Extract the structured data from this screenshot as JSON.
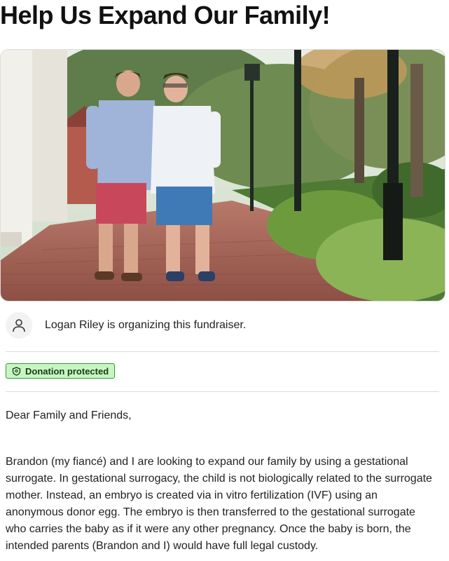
{
  "page": {
    "title": "Help Us Expand Our Family!"
  },
  "hero": {
    "image_icon": "couple-walking-photo"
  },
  "organizer": {
    "icon": "user-icon",
    "text": "Logan Riley is organizing this fundraiser."
  },
  "badge": {
    "icon": "shield-icon",
    "label": "Donation protected",
    "colors": {
      "background": "#c9f5c2",
      "border": "#2a9d3a",
      "text": "#143d16"
    }
  },
  "story": {
    "greeting": "Dear Family and Friends,",
    "paragraph": "Brandon (my fiancé) and I are looking to expand our family by using a gestational surrogate. In gestational surrogacy, the child is not biologically related to the surrogate mother. Instead, an embryo is created via in vitro fertilization (IVF) using an anonymous donor egg. The embryo is then transferred to the gestational surrogate who carries the baby as if it were any other pregnancy. Once the baby is born, the intended parents (Brandon and I) would have full legal custody."
  }
}
